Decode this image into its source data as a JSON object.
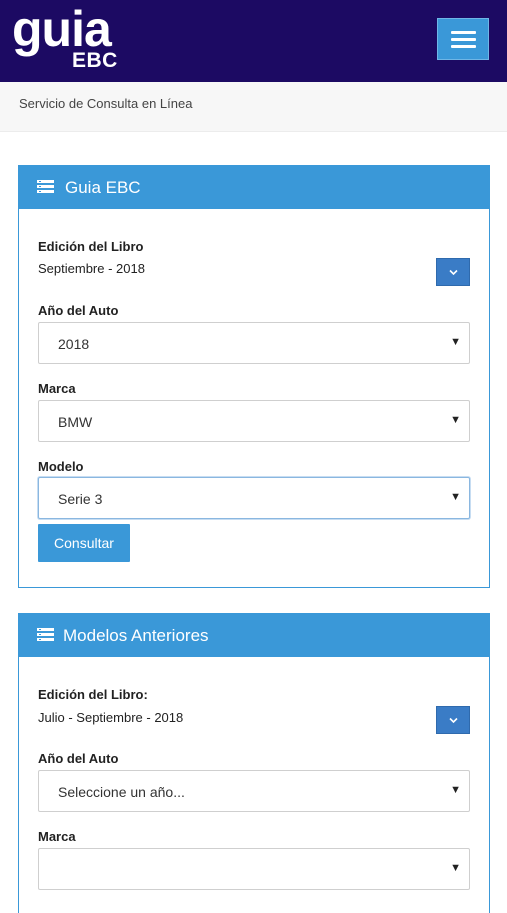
{
  "header": {
    "logo_main": "guia",
    "logo_sub": "EBC",
    "menu_icon": "hamburger-icon"
  },
  "subheader": {
    "text": "Servicio de Consulta en Línea"
  },
  "panel1": {
    "title": "Guia EBC",
    "icon": "list-icon",
    "edition_label": "Edición del Libro",
    "edition_value": "Septiembre - 2018",
    "year_label": "Año del Auto",
    "year_value": "2018",
    "brand_label": "Marca",
    "brand_value": "BMW",
    "model_label": "Modelo",
    "model_value": "Serie 3",
    "submit_label": "Consultar"
  },
  "panel2": {
    "title": "Modelos Anteriores",
    "icon": "list-icon",
    "edition_label": "Edición del Libro:",
    "edition_value": "Julio - Septiembre - 2018",
    "year_label": "Año del Auto",
    "year_placeholder": "Seleccione un año...",
    "brand_label": "Marca",
    "brand_value": ""
  },
  "colors": {
    "header_bg": "#1c0a63",
    "accent": "#3a98d8",
    "chevron_button": "#3a7cc6"
  }
}
